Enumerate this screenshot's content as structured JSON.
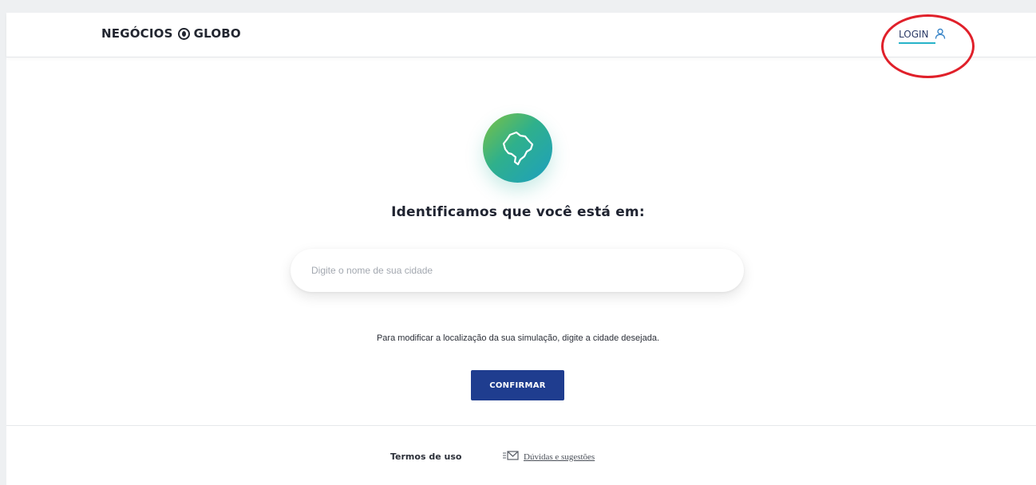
{
  "header": {
    "logo_left": "NEGÓCIOS",
    "logo_right": "GLOBO",
    "login_label": "LOGIN"
  },
  "main": {
    "icon": "brazil-map-icon",
    "title": "Identificamos que você está em:",
    "search_placeholder": "Digite o nome de sua cidade",
    "search_value": "",
    "hint": "Para modificar a localização da sua simulação, digite a cidade desejada.",
    "confirm_label": "CONFIRMAR"
  },
  "footer": {
    "terms_label": "Termos de uso",
    "feedback_label": "Dúvidas e sugestões",
    "feedback_icon": "mail-icon"
  },
  "colors": {
    "primary_button": "#1f3d8f",
    "accent_underline": "#27b3c9",
    "annotation_circle": "#e0202a",
    "icon_gradient_start": "#7cc242",
    "icon_gradient_end": "#1d9fc0"
  }
}
